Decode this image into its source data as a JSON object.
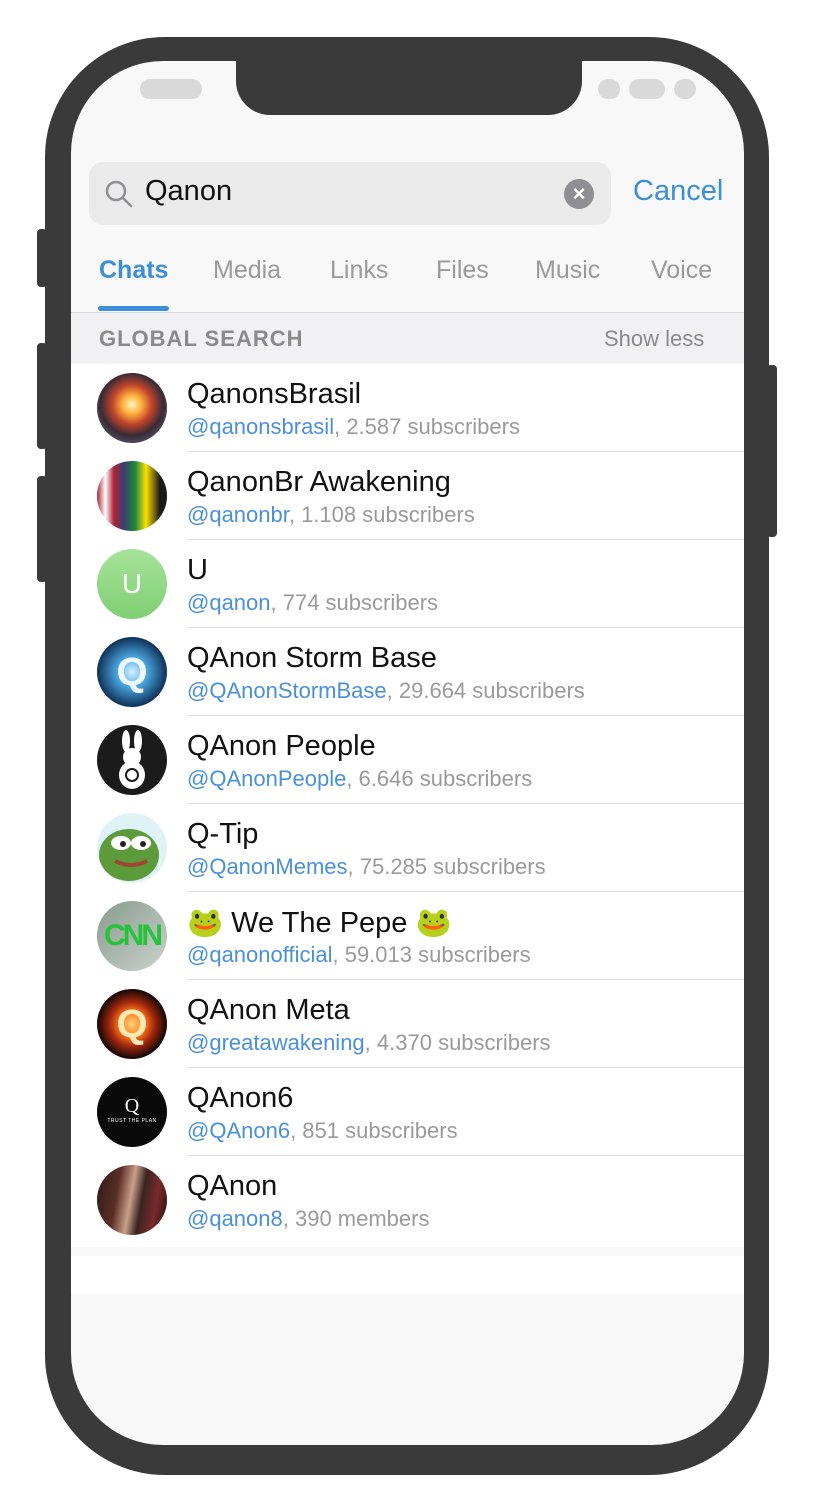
{
  "search": {
    "query": "Qanon",
    "cancel_label": "Cancel"
  },
  "tabs": [
    {
      "label": "Chats",
      "active": true
    },
    {
      "label": "Media",
      "active": false
    },
    {
      "label": "Links",
      "active": false
    },
    {
      "label": "Files",
      "active": false
    },
    {
      "label": "Music",
      "active": false
    },
    {
      "label": "Voice",
      "active": false
    }
  ],
  "section": {
    "title": "GLOBAL SEARCH",
    "toggle_label": "Show less"
  },
  "results": [
    {
      "title": "QanonsBrasil",
      "handle": "@qanonsbrasil",
      "count": ", 2.587 subscribers",
      "avatar": "nuclear-explosion-avatar"
    },
    {
      "title": "QanonBr Awakening",
      "handle": "@qanonbr",
      "count": ", 1.108 subscribers",
      "avatar": "usa-brazil-flag-face-avatar"
    },
    {
      "title": "U",
      "handle": "@qanon",
      "count": ", 774 subscribers",
      "avatar": "letter-u-avatar",
      "initial": "U"
    },
    {
      "title": "QAnon Storm Base",
      "handle": "@QAnonStormBase",
      "count": ", 29.664 subscribers",
      "avatar": "blue-q-storm-avatar"
    },
    {
      "title": "QAnon People",
      "handle": "@QAnonPeople",
      "count": ", 6.646 subscribers",
      "avatar": "white-rabbit-avatar"
    },
    {
      "title": "Q-Tip",
      "handle": "@QanonMemes",
      "count": ", 75.285 subscribers",
      "avatar": "pepe-frog-avatar"
    },
    {
      "title": "🐸 We The Pepe 🐸",
      "handle": "@qanonofficial",
      "count": ", 59.013 subscribers",
      "avatar": "green-cnn-logo-avatar"
    },
    {
      "title": "QAnon Meta",
      "handle": "@greatawakening",
      "count": ", 4.370 subscribers",
      "avatar": "fire-q-avatar"
    },
    {
      "title": "QAnon6",
      "handle": "@QAnon6",
      "count": ", 851 subscribers",
      "avatar": "trust-the-plan-q-avatar",
      "avatar_text": "TRUST THE PLAN"
    },
    {
      "title": "QAnon",
      "handle": "@qanon8",
      "count": ", 390 members",
      "avatar": "person-photo-avatar"
    }
  ],
  "colors": {
    "accent": "#3b8fd9",
    "frame": "#3a3a3a",
    "subtitle": "#9a9a9a"
  }
}
